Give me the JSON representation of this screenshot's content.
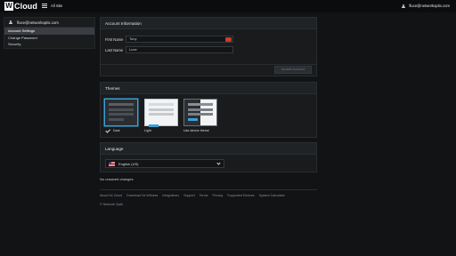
{
  "header": {
    "logo_letter": "W",
    "logo_text": "Cloud",
    "site": "All Site",
    "user_email": "fluce@networkoptix.com"
  },
  "sidebar": {
    "user": "fluce@networkoptix.com",
    "items": [
      {
        "label": "Account Settings",
        "active": true
      },
      {
        "label": "Change Password",
        "active": false
      },
      {
        "label": "Security",
        "active": false
      }
    ]
  },
  "account": {
    "title": "Account Information",
    "first_name_label": "First Name",
    "first_name_value": "Tony",
    "last_name_label": "Last Name",
    "last_name_value": "Luce",
    "field_badge": "...",
    "update_label": "Update Account"
  },
  "themes": {
    "title": "Themes",
    "options": [
      {
        "label": "Dark",
        "selected": true
      },
      {
        "label": "Light",
        "selected": false
      },
      {
        "label": "Use device theme",
        "selected": false
      }
    ]
  },
  "language": {
    "title": "Language",
    "selected": "English (US)"
  },
  "status": "No unsaved changes",
  "footer": {
    "links": [
      "About Nx Cloud",
      "Download Nx Witness",
      "Integrations",
      "Support",
      "Terms",
      "Privacy",
      "Supported Devices",
      "System Calculator"
    ],
    "copyright": "© Network Optix"
  },
  "colors": {
    "accent": "#3aa0d8",
    "badge": "#c8392b",
    "background": "#111315"
  }
}
